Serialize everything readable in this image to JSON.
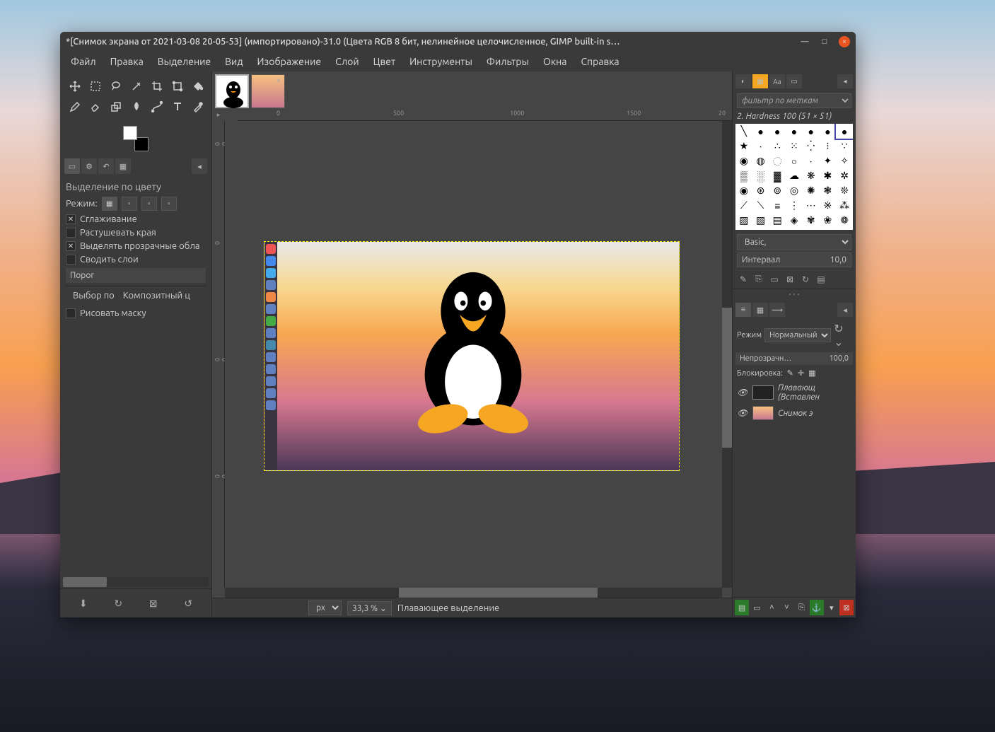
{
  "titlebar": {
    "title": "*[Снимок экрана от 2021-03-08 20-05-53] (импортировано)-31.0 (Цвета RGB 8 бит, нелинейное целочисленное, GIMP built-in s…"
  },
  "menu": [
    "Файл",
    "Правка",
    "Выделение",
    "Вид",
    "Изображение",
    "Слой",
    "Цвет",
    "Инструменты",
    "Фильтры",
    "Окна",
    "Справка"
  ],
  "tooloptions": {
    "title": "Выделение по цвету",
    "mode_label": "Режим:",
    "antialias": "Сглаживание",
    "feather": "Растушевать края",
    "transparent": "Выделять прозрачные обла",
    "flatten": "Сводить слои",
    "threshold": "Порог",
    "selectby": "Выбор по",
    "composite": "Композитный ц",
    "drawmask": "Рисовать маску"
  },
  "ruler_h": {
    "m1": "0",
    "m2": "500",
    "m3": "1000",
    "m4": "1500",
    "m5": "20"
  },
  "ruler_v": {
    "m1": "0",
    "m2": "500",
    "m3": "1000"
  },
  "status": {
    "unit": "px",
    "zoom": "33,3 %",
    "text": "Плавающее выделение"
  },
  "rightdock": {
    "filter_placeholder": "фильтр по меткам",
    "brush_label": "2. Hardness 100 (51 × 51)",
    "preset": "Basic,",
    "interval_label": "Интервал",
    "interval_value": "10,0",
    "mode_label": "Режим",
    "mode_value": "Нормальный",
    "opacity_label": "Непрозрачн…",
    "opacity_value": "100,0",
    "lock_label": "Блокировка:"
  },
  "layers": [
    {
      "name": "Плавающ",
      "sub": "(Вставлен"
    },
    {
      "name": "Снимок э"
    }
  ]
}
